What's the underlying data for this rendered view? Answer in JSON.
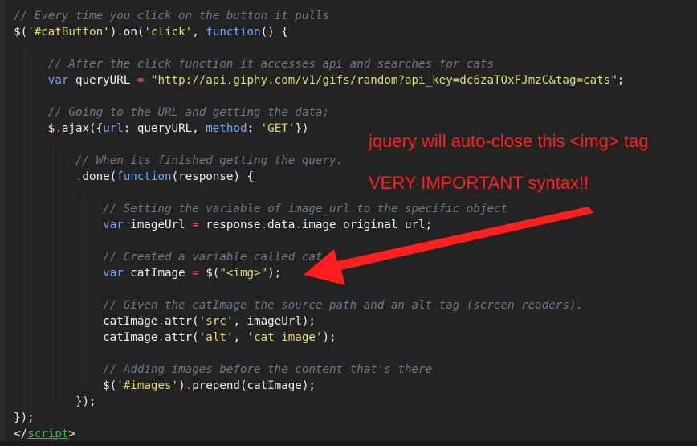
{
  "code": {
    "lines": [
      {
        "parts": [
          {
            "c": "c",
            "t": "// Every time you click on the button it pulls"
          }
        ],
        "indent": "  "
      },
      {
        "parts": [
          {
            "c": "",
            "t": "$("
          },
          {
            "c": "s",
            "t": "'#catButton'"
          },
          {
            "c": "",
            "t": ")"
          },
          {
            "c": "p",
            "t": "."
          },
          {
            "c": "",
            "t": "on("
          },
          {
            "c": "s",
            "t": "'click'"
          },
          {
            "c": "",
            "t": ", "
          },
          {
            "c": "k",
            "t": "function"
          },
          {
            "c": "",
            "t": "() {"
          }
        ],
        "indent": "  "
      },
      {
        "parts": [],
        "indent": ""
      },
      {
        "parts": [
          {
            "c": "c",
            "t": "// After the click function it accesses api and searches for cats"
          }
        ],
        "indent": "       "
      },
      {
        "parts": [
          {
            "c": "k",
            "t": "var"
          },
          {
            "c": "",
            "t": " queryURL "
          },
          {
            "c": "p",
            "t": "="
          },
          {
            "c": "",
            "t": " "
          },
          {
            "c": "s",
            "t": "\"http://api.giphy.com/v1/gifs/random?api_key=dc6zaTOxFJmzC&tag=cats\""
          },
          {
            "c": "",
            "t": ";"
          }
        ],
        "indent": "       "
      },
      {
        "parts": [],
        "indent": ""
      },
      {
        "parts": [
          {
            "c": "c",
            "t": "// Going to the URL and getting the data;"
          }
        ],
        "indent": "       "
      },
      {
        "parts": [
          {
            "c": "",
            "t": "$"
          },
          {
            "c": "p",
            "t": "."
          },
          {
            "c": "",
            "t": "ajax({"
          },
          {
            "c": "k",
            "t": "url"
          },
          {
            "c": "",
            "t": ": queryURL, "
          },
          {
            "c": "k",
            "t": "method"
          },
          {
            "c": "",
            "t": ": "
          },
          {
            "c": "s",
            "t": "'GET'"
          },
          {
            "c": "",
            "t": "})"
          }
        ],
        "indent": "       "
      },
      {
        "parts": [],
        "indent": ""
      },
      {
        "parts": [
          {
            "c": "c",
            "t": "// When its finished getting the query."
          }
        ],
        "indent": "           "
      },
      {
        "parts": [
          {
            "c": "p",
            "t": "."
          },
          {
            "c": "",
            "t": "done("
          },
          {
            "c": "k",
            "t": "function"
          },
          {
            "c": "",
            "t": "(response) {"
          }
        ],
        "indent": "           "
      },
      {
        "parts": [],
        "indent": ""
      },
      {
        "parts": [
          {
            "c": "c",
            "t": "// Setting the variable of image_url to the specific object"
          }
        ],
        "indent": "               "
      },
      {
        "parts": [
          {
            "c": "k",
            "t": "var"
          },
          {
            "c": "",
            "t": " imageUrl "
          },
          {
            "c": "p",
            "t": "="
          },
          {
            "c": "",
            "t": " response"
          },
          {
            "c": "p",
            "t": "."
          },
          {
            "c": "",
            "t": "data"
          },
          {
            "c": "p",
            "t": "."
          },
          {
            "c": "",
            "t": "image_original_url;"
          }
        ],
        "indent": "               "
      },
      {
        "parts": [],
        "indent": ""
      },
      {
        "parts": [
          {
            "c": "c",
            "t": "// Created a variable called cat i"
          }
        ],
        "indent": "               "
      },
      {
        "parts": [
          {
            "c": "k",
            "t": "var"
          },
          {
            "c": "",
            "t": " catImage "
          },
          {
            "c": "p",
            "t": "="
          },
          {
            "c": "",
            "t": " $("
          },
          {
            "c": "s",
            "t": "\"<img>\""
          },
          {
            "c": "",
            "t": ");"
          }
        ],
        "indent": "               "
      },
      {
        "parts": [],
        "indent": ""
      },
      {
        "parts": [
          {
            "c": "c",
            "t": "// Given the catImage the source path and an alt tag (screen readers)."
          }
        ],
        "indent": "               "
      },
      {
        "parts": [
          {
            "c": "",
            "t": "catImage"
          },
          {
            "c": "p",
            "t": "."
          },
          {
            "c": "",
            "t": "attr("
          },
          {
            "c": "s",
            "t": "'src'"
          },
          {
            "c": "",
            "t": ", imageUrl);"
          }
        ],
        "indent": "               "
      },
      {
        "parts": [
          {
            "c": "",
            "t": "catImage"
          },
          {
            "c": "p",
            "t": "."
          },
          {
            "c": "",
            "t": "attr("
          },
          {
            "c": "s",
            "t": "'alt'"
          },
          {
            "c": "",
            "t": ", "
          },
          {
            "c": "s",
            "t": "'cat image'"
          },
          {
            "c": "",
            "t": ");"
          }
        ],
        "indent": "               "
      },
      {
        "parts": [],
        "indent": ""
      },
      {
        "parts": [
          {
            "c": "c",
            "t": "// Adding images before the content that's there"
          }
        ],
        "indent": "               "
      },
      {
        "parts": [
          {
            "c": "",
            "t": "$("
          },
          {
            "c": "s",
            "t": "'#images'"
          },
          {
            "c": "",
            "t": ")"
          },
          {
            "c": "p",
            "t": "."
          },
          {
            "c": "",
            "t": "prepend(catImage);"
          }
        ],
        "indent": "               "
      },
      {
        "parts": [
          {
            "c": "",
            "t": "});"
          }
        ],
        "indent": "           "
      },
      {
        "parts": [
          {
            "c": "",
            "t": "});"
          }
        ],
        "indent": "  "
      },
      {
        "parts": [
          {
            "c": "",
            "t": "</"
          },
          {
            "c": "t",
            "t": "script"
          },
          {
            "c": "",
            "t": ">"
          }
        ],
        "indent": "  "
      }
    ]
  },
  "annotations": {
    "line1": "jquery will auto-close this <img> tag",
    "line2": "VERY IMPORTANT syntax!!"
  },
  "colors": {
    "background": "#232323",
    "comment": "#6c7a89",
    "string": "#e6db74",
    "keyword": "#6fa8ff",
    "punctuation": "#ff5a5a",
    "tag": "#4caf50",
    "annotation": "#ff1f1f"
  }
}
